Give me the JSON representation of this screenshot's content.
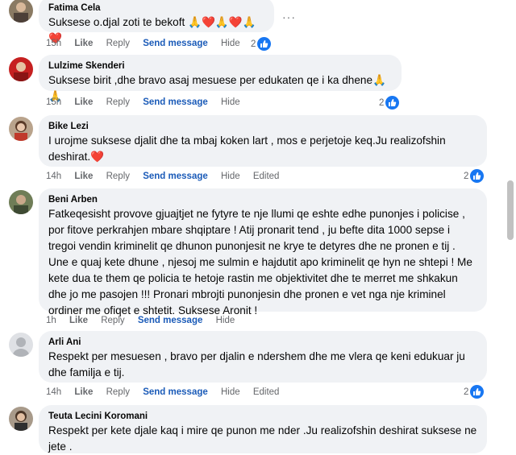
{
  "comments": [
    {
      "author": "Fatima Cela",
      "text": "Suksese o.djal zoti te bekoft 🙏❤️🙏❤️🙏❤️",
      "time": "15h",
      "like": "Like",
      "reply": "Reply",
      "send": "Send message",
      "hide": "Hide",
      "edited": "",
      "reactions": "2"
    },
    {
      "author": "Lulzime Skenderi",
      "text": "Suksese birit ,dhe bravo asaj mesuese per edukaten qe i ka dhene🙏🙏",
      "time": "15h",
      "like": "Like",
      "reply": "Reply",
      "send": "Send message",
      "hide": "Hide",
      "edited": "",
      "reactions": "2"
    },
    {
      "author": "Bike Lezi",
      "text": "I urojme suksese djalit dhe ta mbaj koken lart , mos e perjetoje keq.Ju realizofshin deshirat.❤️",
      "time": "14h",
      "like": "Like",
      "reply": "Reply",
      "send": "Send message",
      "hide": "Hide",
      "edited": "Edited",
      "reactions": "2"
    },
    {
      "author": "Beni Arben",
      "text": "Fatkeqesisht provove gjuajtjet ne fytyre te nje llumi qe eshte edhe punonjes i policise , por fitove perkrahjen mbare shqiptare ! Atij pronarit tend , ju befte dita 1000 sepse i tregoi vendin kriminelit qe dhunon punonjesit ne krye te detyres dhe ne pronen e tij . Une e quaj kete dhune , njesoj me sulmin e hajdutit apo kriminelit qe hyn ne shtepi ! Me kete dua te them qe policia te hetoje rastin me objektivitet dhe te merret me shkakun dhe jo me pasojen !!! Pronari mbrojti punonjesin dhe pronen e vet nga nje kriminel ordiner me ofiqet e shtetit. Suksese Aronit !",
      "time": "1h",
      "like": "Like",
      "reply": "Reply",
      "send": "Send message",
      "hide": "Hide",
      "edited": "",
      "reactions": ""
    },
    {
      "author": "Arli Ani",
      "text": "Respekt per mesuesen , bravo per djalin e ndershem dhe me vlera qe keni edukuar ju dhe familja e tij.",
      "time": "14h",
      "like": "Like",
      "reply": "Reply",
      "send": "Send message",
      "hide": "Hide",
      "edited": "Edited",
      "reactions": "2"
    },
    {
      "author": "Teuta Lecini Koromani",
      "text": "Respekt per kete djale kaq i mire qe punon me nder .Ju realizofshin deshirat suksese ne jete .",
      "time": "",
      "like": "",
      "reply": "",
      "send": "",
      "hide": "",
      "edited": "",
      "reactions": ""
    }
  ],
  "more_label": "···",
  "colors": {
    "bubble": "#f0f2f5",
    "link": "#1b5bb8",
    "meta": "#65676b",
    "like_badge": "#1877f2"
  }
}
